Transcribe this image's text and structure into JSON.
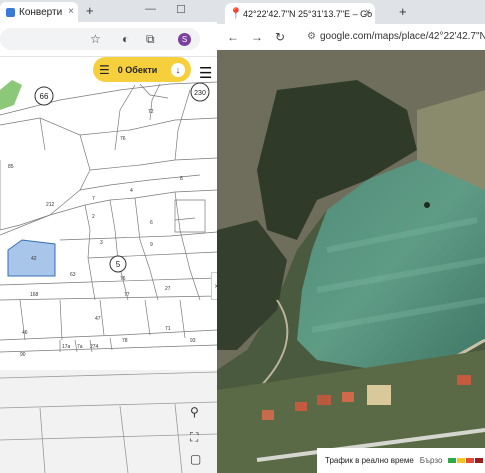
{
  "left_window": {
    "tab_title": "Конверти",
    "tab_close_label": "×",
    "new_tab_label": "+",
    "window_min_label": "—",
    "window_restore_label": "☐",
    "profile_initial": "S",
    "objects_button": {
      "menu_glyph": "☰",
      "label": "0 Обекти",
      "download_glyph": "↓"
    },
    "menu_glyph": "☰",
    "side_toggle_glyph": "›",
    "cadastre_labels": [
      "66",
      "230",
      "85",
      "212",
      "2",
      "3",
      "4",
      "5",
      "6",
      "7",
      "8",
      "9",
      "27",
      "42",
      "63",
      "76",
      "77",
      "168",
      "46",
      "47",
      "71",
      "72",
      "76",
      "17a",
      "7a",
      "274",
      "90",
      "78",
      "93"
    ],
    "icons": [
      "star-icon",
      "extensions-icon",
      "location-pin-icon",
      "fullscreen-icon"
    ]
  },
  "right_window": {
    "tab_title": "42°22'42.7\"N 25°31'13.7\"E – Go",
    "tab_close_label": "×",
    "new_tab_label": "+",
    "url": "google.com/maps/place/42°22'42.7\"N+25°",
    "traffic_label": "Трафик в реално време",
    "traffic_fast": "Бързо",
    "traffic_colors": [
      "#2ea84a",
      "#f2c624",
      "#e84a3a",
      "#9b1c1c"
    ]
  }
}
